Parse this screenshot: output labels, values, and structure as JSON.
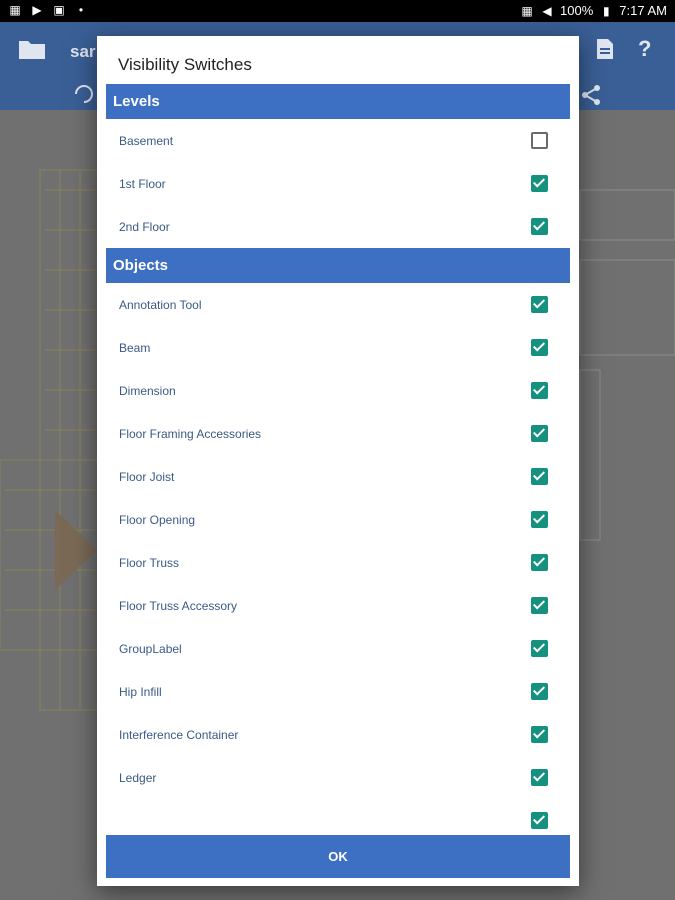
{
  "status_bar": {
    "icons_left": [
      "notification-icon",
      "play-store-icon",
      "image-icon"
    ],
    "icons_right": [
      "vibrate-icon",
      "wifi-icon",
      "battery-icon"
    ],
    "battery": "100%",
    "time": "7:17 AM"
  },
  "app_bar": {
    "title": "sar",
    "icons": [
      "folder-icon",
      "document-icon",
      "help-icon",
      "rotate-icon",
      "share-icon"
    ],
    "color": "#3a5f96"
  },
  "dialog": {
    "title": "Visibility Switches",
    "sections": [
      {
        "name": "Levels",
        "items": [
          {
            "label": "Basement",
            "checked": false
          },
          {
            "label": "1st Floor",
            "checked": true
          },
          {
            "label": "2nd Floor",
            "checked": true
          }
        ]
      },
      {
        "name": "Objects",
        "items": [
          {
            "label": "Annotation Tool",
            "checked": true
          },
          {
            "label": "Beam",
            "checked": true
          },
          {
            "label": "Dimension",
            "checked": true
          },
          {
            "label": "Floor Framing Accessories",
            "checked": true
          },
          {
            "label": "Floor Joist",
            "checked": true
          },
          {
            "label": "Floor Opening",
            "checked": true
          },
          {
            "label": "Floor Truss",
            "checked": true
          },
          {
            "label": "Floor Truss Accessory",
            "checked": true
          },
          {
            "label": "GroupLabel",
            "checked": true
          },
          {
            "label": "Hip Infill",
            "checked": true
          },
          {
            "label": "Interference Container",
            "checked": true
          },
          {
            "label": "Ledger",
            "checked": true
          },
          {
            "label": "",
            "checked": true
          }
        ]
      }
    ],
    "ok_label": "OK",
    "colors": {
      "header": "#3d6fc2",
      "checkbox_on": "#16907f",
      "label_text": "#3a5a86"
    }
  }
}
